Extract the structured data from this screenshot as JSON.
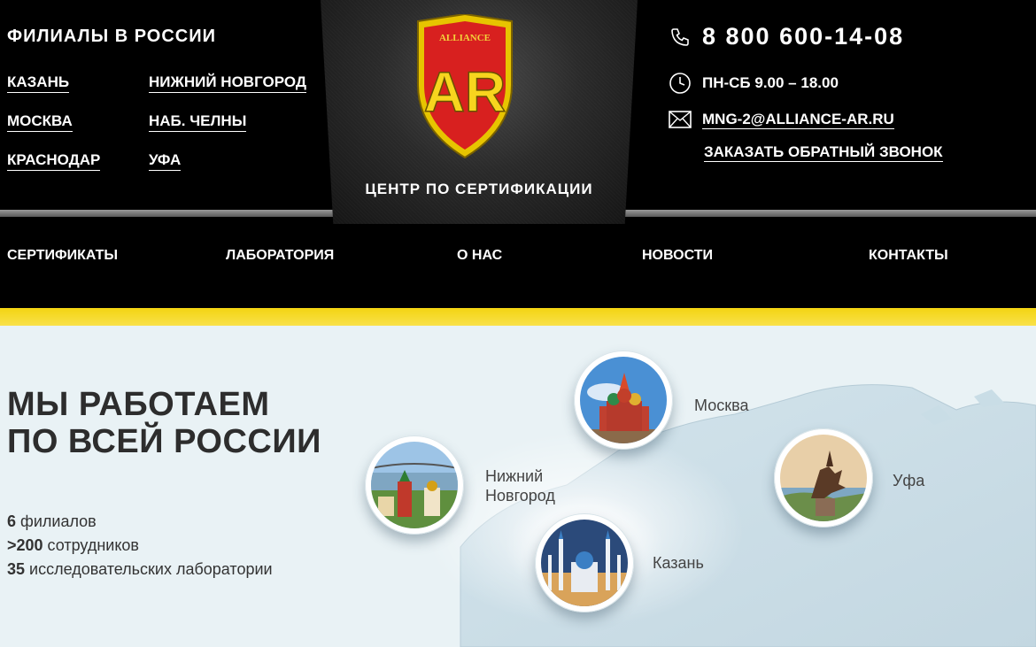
{
  "header": {
    "branches_title": "ФИЛИАЛЫ В РОССИИ",
    "branches": [
      "КАЗАНЬ",
      "НИЖНИЙ НОВГОРОД",
      "МОСКВА",
      "НАБ. ЧЕЛНЫ",
      "КРАСНОДАР",
      "УФА"
    ],
    "logo_letters": "AR",
    "logo_text": "ALLIANCE",
    "center_caption": "ЦЕНТР ПО СЕРТИФИКАЦИИ",
    "phone": "8 800 600-14-08",
    "hours": "ПН-СБ 9.00 – 18.00",
    "email": "MNG-2@ALLIANCE-AR.RU",
    "callback": "ЗАКАЗАТЬ ОБРАТНЫЙ ЗВОНОК",
    "icons": {
      "phone": "phone-icon",
      "clock": "clock-icon",
      "mail": "mail-icon"
    }
  },
  "nav": [
    "СЕРТИФИКАТЫ",
    "ЛАБОРАТОРИЯ",
    "О НАС",
    "НОВОСТИ",
    "КОНТАКТЫ"
  ],
  "main": {
    "headline_line1": "МЫ РАБОТАЕМ",
    "headline_line2": "ПО ВСЕЙ РОССИИ",
    "stats": [
      {
        "num": "6",
        "text": " филиалов"
      },
      {
        "num": ">200",
        "text": " сотрудников"
      },
      {
        "num": "35",
        "text": " исследовательских лаборатории"
      }
    ],
    "cities": {
      "moscow": "Москва",
      "nn_line1": "Нижний",
      "nn_line2": "Новгород",
      "ufa": "Уфа",
      "kazan": "Казань"
    }
  },
  "colors": {
    "accent_yellow": "#f3d412",
    "logo_red": "#d8201f",
    "header_bg": "#000000",
    "main_bg": "#e9f2f5"
  }
}
